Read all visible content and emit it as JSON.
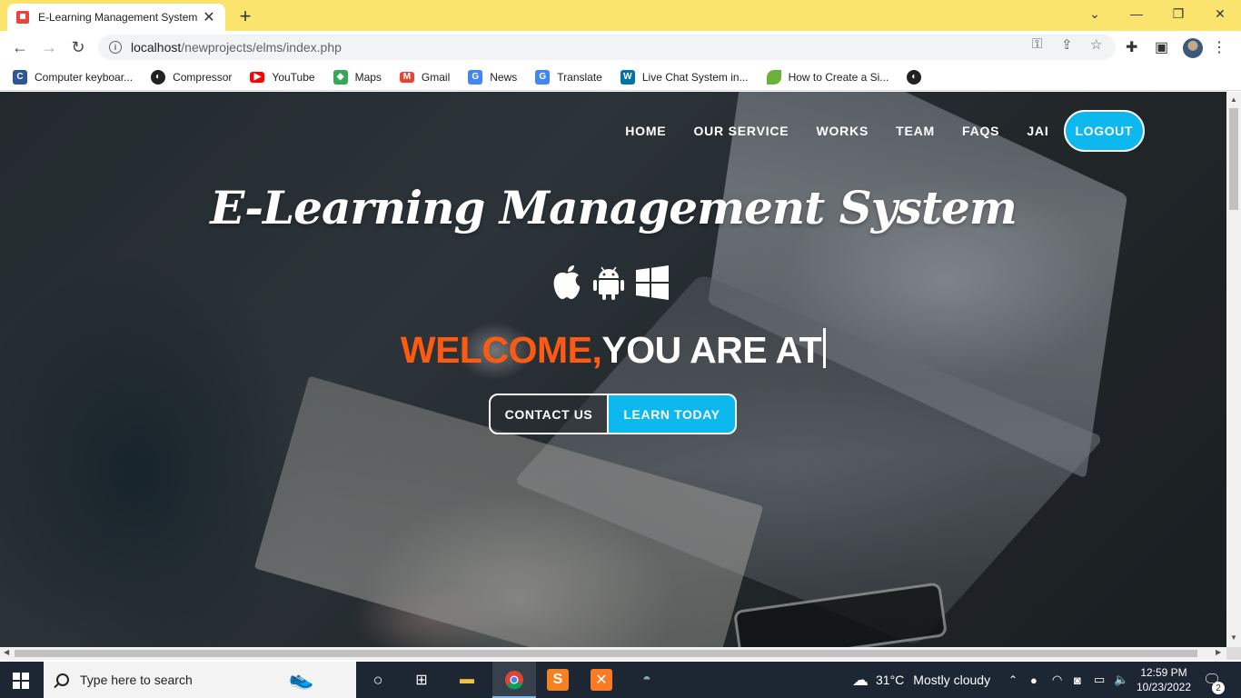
{
  "browser": {
    "tab_title": "E-Learning Management System",
    "url_host": "localhost",
    "url_path": "/newprojects/elms/index.php"
  },
  "bookmarks": [
    {
      "label": "Computer keyboar...",
      "icon": "keyboard-icon",
      "color": "#2b5797"
    },
    {
      "label": "Compressor",
      "icon": "compressor-icon",
      "color": "#222222"
    },
    {
      "label": "YouTube",
      "icon": "youtube-icon",
      "color": "#ff0000"
    },
    {
      "label": "Maps",
      "icon": "maps-icon",
      "color": "#34a853"
    },
    {
      "label": "Gmail",
      "icon": "gmail-icon",
      "color": "#ea4335"
    },
    {
      "label": "News",
      "icon": "news-icon",
      "color": "#4285f4"
    },
    {
      "label": "Translate",
      "icon": "translate-icon",
      "color": "#4285f4"
    },
    {
      "label": "Live Chat System in...",
      "icon": "wordpress-icon",
      "color": "#0073aa"
    },
    {
      "label": "How to Create a Si...",
      "icon": "leaf-icon",
      "color": "#6bb23a"
    }
  ],
  "site": {
    "nav": [
      "HOME",
      "OUR SERVICE",
      "WORKS",
      "TEAM",
      "FAQS",
      "JAI"
    ],
    "logout": "LOGOUT",
    "hero_title": "E-Learning Management System",
    "welcome_colored": "WELCOME,",
    "welcome_white": "YOU ARE AT",
    "contact_button": "CONTACT US",
    "learn_button": "LEARN TODAY",
    "accent_color": "#0cb8ee",
    "welcome_color": "#ff5a12"
  },
  "taskbar": {
    "search_placeholder": "Type here to search",
    "weather_temp": "31°C",
    "weather_text": "Mostly cloudy",
    "time": "12:59 PM",
    "date": "10/23/2022",
    "notification_count": "2"
  }
}
